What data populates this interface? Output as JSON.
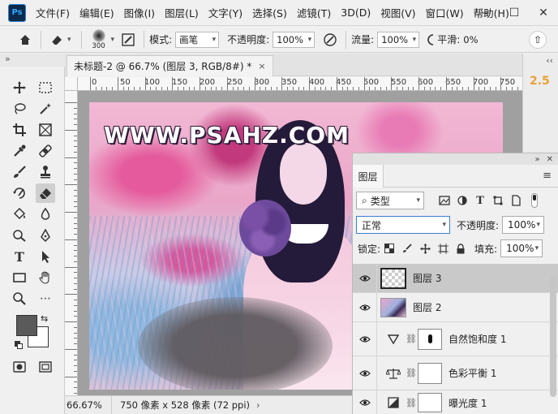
{
  "app": {
    "logo": "Ps"
  },
  "menu": [
    "文件(F)",
    "编辑(E)",
    "图像(I)",
    "图层(L)",
    "文字(Y)",
    "选择(S)",
    "滤镜(T)",
    "3D(D)",
    "视图(V)",
    "窗口(W)",
    "帮助(H)"
  ],
  "window_controls": {
    "minimize": "—",
    "maximize": "☐",
    "close": "✕"
  },
  "options": {
    "brush_size": "300",
    "mode_label": "模式:",
    "mode_value": "画笔",
    "opacity_label": "不透明度:",
    "opacity_value": "100%",
    "flow_label": "流量:",
    "flow_value": "100%",
    "smooth_label": "平滑:",
    "smooth_value": "0%"
  },
  "document": {
    "tab_title": "未标题-2 @ 66.7% (图层 3, RGB/8#) *",
    "close": "×",
    "watermark": "WWW.PSAHZ.COM"
  },
  "ruler": {
    "top_labels": [
      "0",
      "50",
      "100",
      "150",
      "200",
      "250",
      "300",
      "350",
      "400",
      "450",
      "500",
      "550",
      "600",
      "650",
      "700",
      "750"
    ]
  },
  "status": {
    "zoom": "66.67%",
    "info": "750 像素 x 528 像素 (72 ppi)",
    "arrow": "›"
  },
  "right_strip": {
    "badge": "2.5",
    "chevron": "‹‹"
  },
  "layers_panel": {
    "tab_label": "图层",
    "filter_value": "类型",
    "blend_mode": "正常",
    "opacity_label": "不透明度:",
    "opacity_value": "100%",
    "lock_label": "锁定:",
    "fill_label": "填充:",
    "fill_value": "100%",
    "layers": [
      {
        "name": "图层 3",
        "kind": "transparent",
        "selected": true
      },
      {
        "name": "图层 2",
        "kind": "photo",
        "selected": false
      },
      {
        "name": "自然饱和度 1",
        "kind": "vibrance",
        "selected": false
      },
      {
        "name": "色彩平衡 1",
        "kind": "color-balance",
        "selected": false
      },
      {
        "name": "曝光度 1",
        "kind": "exposure",
        "selected": false
      }
    ]
  },
  "colors": {
    "foreground": "#5a5a5a",
    "background": "#ffffff",
    "accent": "#e8a23a",
    "selected_layer": "#c9c9c9"
  }
}
